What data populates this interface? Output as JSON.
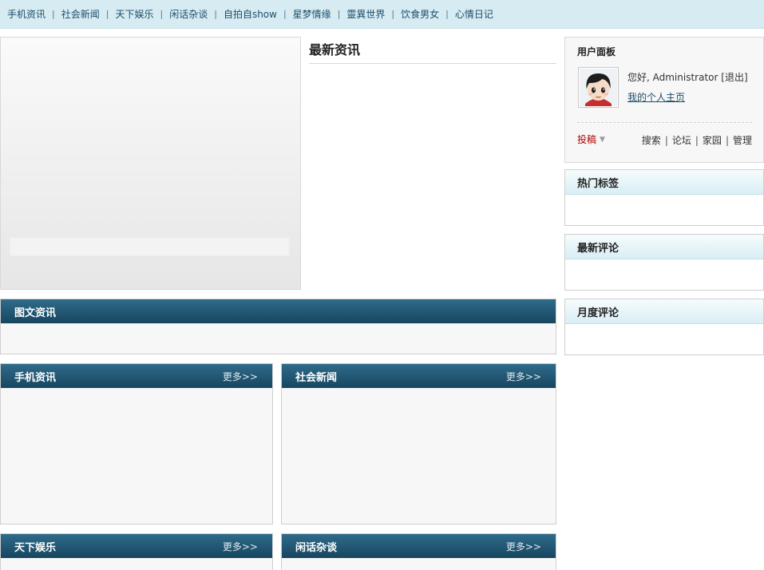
{
  "nav": {
    "items": [
      {
        "label": "手机资讯"
      },
      {
        "label": "社会新闻"
      },
      {
        "label": "天下娱乐"
      },
      {
        "label": "闲话杂谈"
      },
      {
        "label": "自拍自show"
      },
      {
        "label": "星梦情缘"
      },
      {
        "label": "靈異世界"
      },
      {
        "label": "饮食男女"
      },
      {
        "label": "心情日记"
      }
    ],
    "separator": "|"
  },
  "latest": {
    "title": "最新资讯"
  },
  "picnews": {
    "title": "图文资讯"
  },
  "sections": [
    {
      "title": "手机资讯",
      "more": "更多>>"
    },
    {
      "title": "社会新闻",
      "more": "更多>>"
    },
    {
      "title": "天下娱乐",
      "more": "更多>>"
    },
    {
      "title": "闲话杂谈",
      "more": "更多>>"
    }
  ],
  "user_panel": {
    "title": "用户面板",
    "greeting": "您好, Administrator",
    "logout": "[退出]",
    "homepage": "我的个人主页",
    "submit": "投稿",
    "links": [
      "搜索",
      "论坛",
      "家园",
      "管理"
    ],
    "link_separator": "|"
  },
  "sidebar": {
    "hot_tags": "热门标签",
    "latest_comments": "最新评论",
    "monthly_comments": "月度评论"
  },
  "colors": {
    "nav_bg": "#d6ecf2",
    "section_header": "#1e5470",
    "accent_red": "#b00000",
    "link_blue": "#1d4d6b"
  }
}
